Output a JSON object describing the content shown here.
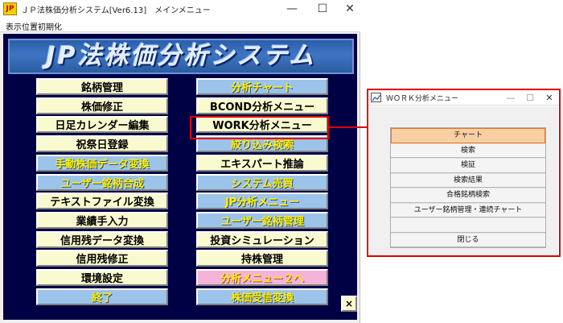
{
  "main_window": {
    "title": "ＪＰ法株価分析システム[Ver6.13]　メインメニュー",
    "icon_text": "JP",
    "menu": {
      "reset_position": "表示位置初期化"
    },
    "banner": "JP法株価分析システム",
    "left_buttons": [
      {
        "label": "銘柄管理",
        "style": "cream"
      },
      {
        "label": "株価修正",
        "style": "cream"
      },
      {
        "label": "日足カレンダー編集",
        "style": "cream"
      },
      {
        "label": "祝祭日登録",
        "style": "cream"
      },
      {
        "label": "手動株価データ変換",
        "style": "blue"
      },
      {
        "label": "ユーザー銘柄合成",
        "style": "blue"
      },
      {
        "label": "テキストファイル変換",
        "style": "cream"
      },
      {
        "label": "業績手入力",
        "style": "cream"
      },
      {
        "label": "信用残データ変換",
        "style": "cream"
      },
      {
        "label": "信用残修正",
        "style": "cream"
      },
      {
        "label": "環境設定",
        "style": "cream"
      },
      {
        "label": "終了",
        "style": "blue"
      }
    ],
    "right_buttons": [
      {
        "label": "分析チャート",
        "style": "blue"
      },
      {
        "label": "BCOND分析メニュー",
        "style": "cream"
      },
      {
        "label": "WORK分析メニュー",
        "style": "cream"
      },
      {
        "label": "絞り込み検索",
        "style": "blue"
      },
      {
        "label": "エキスパート推論",
        "style": "cream"
      },
      {
        "label": "システム売買",
        "style": "blue"
      },
      {
        "label": "JP分析メニュー",
        "style": "blue"
      },
      {
        "label": "ユーザー銘柄管理",
        "style": "blue"
      },
      {
        "label": "投資シミュレーション",
        "style": "cream"
      },
      {
        "label": "持株管理",
        "style": "cream"
      },
      {
        "label": "分析メニュー２へ",
        "style": "pink"
      },
      {
        "label": "株価受信変換",
        "style": "blue"
      }
    ],
    "small_close": "×"
  },
  "sub_window": {
    "title": "ＷＯＲＫ分析メニュー",
    "items": [
      "チャート",
      "検索",
      "検証",
      "検索結果",
      "合格銘柄検索",
      "ユーザー銘柄管理・連続チャート",
      "",
      "閉じる"
    ],
    "selected_index": 0
  },
  "colors": {
    "client_bg": "#000044",
    "cream": "#fafad0",
    "blue": "#9cc4ea",
    "pink": "#f4b3d8",
    "button_text_yellow": "#fff000",
    "highlight_red": "#e00000"
  }
}
